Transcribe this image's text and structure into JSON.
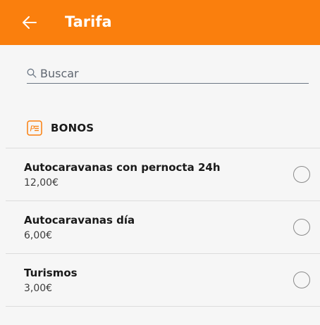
{
  "colors": {
    "header_bg": "#fa7f0d",
    "header_text": "#ffffff",
    "section_icon": "#fa7f0d"
  },
  "header": {
    "back_icon": "arrow-left-icon",
    "title": "Tarifa"
  },
  "search": {
    "icon": "search-icon",
    "placeholder": "Buscar",
    "value": ""
  },
  "section": {
    "icon": "parking-ticket-icon",
    "label": "BONOS"
  },
  "items": [
    {
      "name": "Autocaravanas con pernocta 24h",
      "price": "12,00€",
      "selected": false
    },
    {
      "name": "Autocaravanas día",
      "price": "6,00€",
      "selected": false
    },
    {
      "name": "Turismos",
      "price": "3,00€",
      "selected": false
    }
  ]
}
